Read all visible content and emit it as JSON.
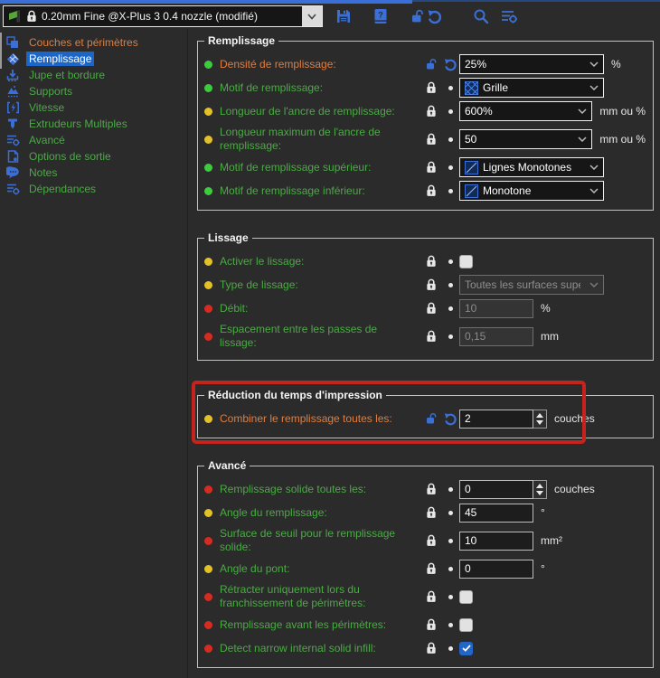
{
  "toolbar": {
    "preset": "0.20mm Fine @X-Plus 3 0.4 nozzle (modifié)",
    "buttons": [
      "save-preset",
      "help-book",
      "reset-unlock",
      "search",
      "mode-settings"
    ]
  },
  "sidebar": {
    "items": [
      {
        "label": "Couches et périmètres",
        "state": "modified",
        "icon": "layers-icon"
      },
      {
        "label": "Remplissage",
        "state": "selected",
        "icon": "infill-icon"
      },
      {
        "label": "Jupe et bordure",
        "state": "normal",
        "icon": "skirt-icon"
      },
      {
        "label": "Supports",
        "state": "normal",
        "icon": "supports-icon"
      },
      {
        "label": "Vitesse",
        "state": "normal",
        "icon": "speed-icon"
      },
      {
        "label": "Extrudeurs Multiples",
        "state": "normal",
        "icon": "extruder-icon"
      },
      {
        "label": "Avancé",
        "state": "normal",
        "icon": "sliders-gear-icon"
      },
      {
        "label": "Options de sortie",
        "state": "normal",
        "icon": "output-doc-icon"
      },
      {
        "label": "Notes",
        "state": "normal",
        "icon": "speech-bubble-icon"
      },
      {
        "label": "Dépendances",
        "state": "normal",
        "icon": "sliders-gear-icon"
      }
    ]
  },
  "sections": [
    {
      "title": "Remplissage",
      "rows": [
        {
          "label": "Densité de remplissage:",
          "value": "25%",
          "unit": "%",
          "dot": "green",
          "modified": true,
          "control": "combo"
        },
        {
          "label": "Motif de remplissage:",
          "value": "Grille",
          "unit": "",
          "dot": "green",
          "modified": false,
          "control": "combo-icon",
          "pattern_icon": "grid-pattern-icon"
        },
        {
          "label": "Longueur de l'ancre de remplissage:",
          "value": "600%",
          "unit": "mm ou %",
          "dot": "yellow",
          "modified": false,
          "control": "combo"
        },
        {
          "label": "Longueur maximum de l'ancre de remplissage:",
          "value": "50",
          "unit": "mm ou %",
          "dot": "yellow",
          "modified": false,
          "control": "combo"
        },
        {
          "label": "Motif de remplissage supérieur:",
          "value": "Lignes Monotones",
          "unit": "",
          "dot": "green",
          "modified": false,
          "control": "combo-icon",
          "pattern_icon": "diagonal-lines-pattern-icon"
        },
        {
          "label": "Motif de remplissage inférieur:",
          "value": "Monotone",
          "unit": "",
          "dot": "green",
          "modified": false,
          "control": "combo-icon",
          "pattern_icon": "diagonal-lines-pattern-icon"
        }
      ]
    },
    {
      "title": "Lissage",
      "rows": [
        {
          "label": "Activer le lissage:",
          "value": "",
          "unit": "",
          "dot": "yellow",
          "modified": false,
          "control": "checkbox",
          "checked": false
        },
        {
          "label": "Type de lissage:",
          "value": "Toutes les surfaces supé",
          "unit": "",
          "dot": "yellow",
          "modified": false,
          "control": "combo-disabled"
        },
        {
          "label": "Débit:",
          "value": "10",
          "unit": "%",
          "dot": "red",
          "modified": false,
          "control": "input-disabled"
        },
        {
          "label": "Espacement entre les passes de lissage:",
          "value": "0,15",
          "unit": "mm",
          "dot": "red",
          "modified": false,
          "control": "input-disabled"
        }
      ]
    },
    {
      "title": "Réduction du temps d'impression",
      "highlighted": true,
      "rows": [
        {
          "label": "Combiner le remplissage toutes les:",
          "value": "2",
          "unit": "couches",
          "dot": "yellow",
          "modified": true,
          "control": "spinner"
        }
      ]
    },
    {
      "title": "Avancé",
      "rows": [
        {
          "label": "Remplissage solide toutes les:",
          "value": "0",
          "unit": "couches",
          "dot": "red",
          "modified": false,
          "control": "spinner"
        },
        {
          "label": "Angle du remplissage:",
          "value": "45",
          "unit": "°",
          "dot": "yellow",
          "modified": false,
          "control": "input"
        },
        {
          "label": "Surface de seuil pour le remplissage solide:",
          "value": "10",
          "unit": "mm²",
          "dot": "red",
          "modified": false,
          "control": "input"
        },
        {
          "label": "Angle du pont:",
          "value": "0",
          "unit": "°",
          "dot": "yellow",
          "modified": false,
          "control": "input"
        },
        {
          "label": "Rétracter uniquement lors du franchissement de périmètres:",
          "value": "",
          "unit": "",
          "dot": "red",
          "modified": false,
          "control": "checkbox",
          "checked": false
        },
        {
          "label": "Remplissage avant les périmètres:",
          "value": "",
          "unit": "",
          "dot": "red",
          "modified": false,
          "control": "checkbox",
          "checked": false
        },
        {
          "label": "Detect narrow internal solid infill:",
          "value": "",
          "unit": "",
          "dot": "red",
          "modified": false,
          "control": "checkbox",
          "checked": true
        }
      ]
    }
  ],
  "colors": {
    "background": "#2b2b2b",
    "accent_blue": "#3a6fd8",
    "selection_blue": "#1c66c7",
    "label_green": "#4aab44",
    "label_modified_orange": "#e17d3d",
    "highlight_red": "#c5241c",
    "dot_green": "#3ecb3e",
    "dot_yellow": "#e3c229",
    "dot_red": "#d62b20",
    "checkbox_checked_blue": "#2166c8"
  }
}
